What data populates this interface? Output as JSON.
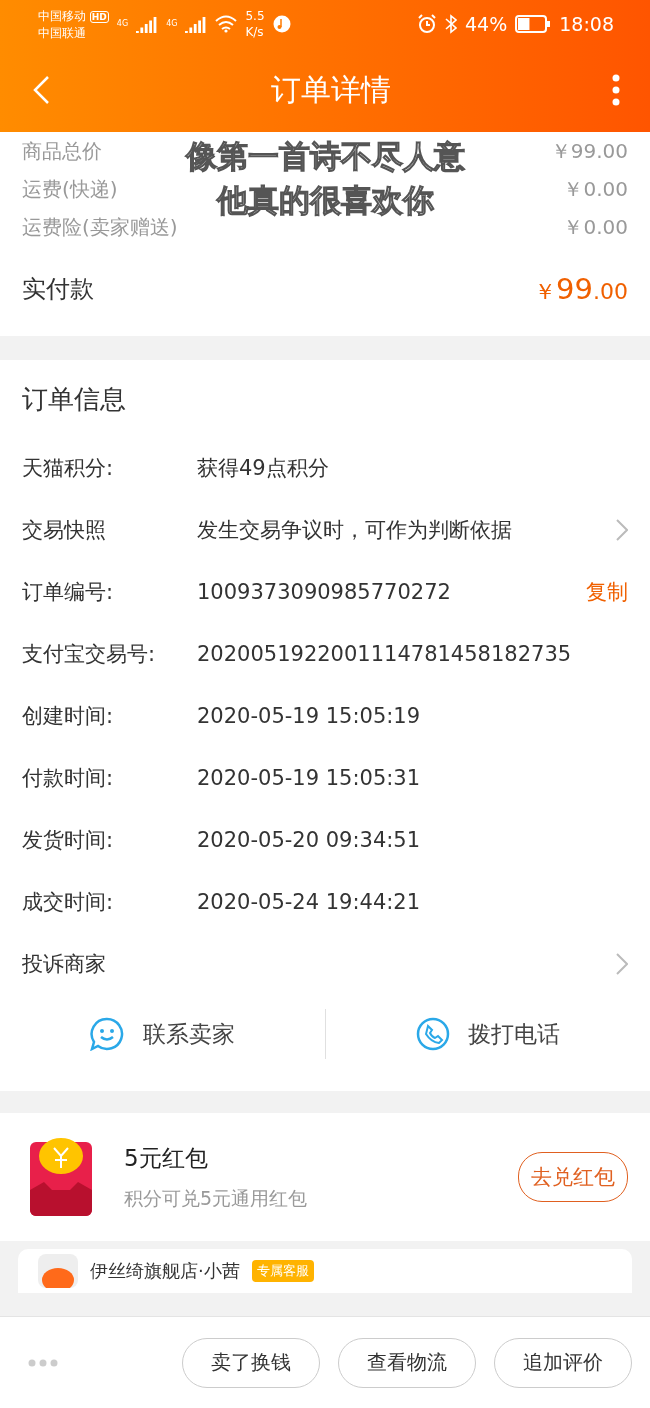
{
  "status_bar": {
    "carrier_1": "中国移动",
    "hd": "HD",
    "carrier_2": "中国联通",
    "net_1": "4G",
    "net_2": "4G",
    "speed_value": "5.5",
    "speed_unit": "K/s",
    "battery": "44%",
    "time": "18:08"
  },
  "nav": {
    "title": "订单详情"
  },
  "caption": [
    "像第一首诗不尽人意",
    "他真的很喜欢你"
  ],
  "price_rows": [
    {
      "label": "商品总价",
      "value": "￥99.00"
    },
    {
      "label": "运费(快递)",
      "value": "￥0.00"
    },
    {
      "label": "运费险(卖家赠送)",
      "value": "￥0.00"
    }
  ],
  "total": {
    "label": "实付款",
    "currency": "￥",
    "integer": "99",
    "decimal": ".00"
  },
  "order_info": {
    "title": "订单信息",
    "rows": [
      {
        "label": "天猫积分:",
        "value": "获得49点积分"
      },
      {
        "label": "交易快照",
        "value": "发生交易争议时，可作为判断依据",
        "kind": "chevron"
      },
      {
        "label": "订单编号:",
        "value": "1009373090985770272",
        "kind": "copy",
        "action": "复制"
      },
      {
        "label": "支付宝交易号:",
        "value": "2020051922001114781458182735"
      },
      {
        "label": "创建时间:",
        "value": "2020-05-19 15:05:19"
      },
      {
        "label": "付款时间:",
        "value": "2020-05-19 15:05:31"
      },
      {
        "label": "发货时间:",
        "value": "2020-05-20 09:34:51"
      },
      {
        "label": "成交时间:",
        "value": "2020-05-24 19:44:21"
      },
      {
        "label": "投诉商家",
        "kind": "chevron"
      }
    ],
    "contacts": [
      {
        "label": "联系卖家",
        "kind": "chat"
      },
      {
        "label": "拨打电话",
        "kind": "phone"
      }
    ]
  },
  "red_packet": {
    "title": "5元红包",
    "subtitle": "积分可兑5元通用红包",
    "button": "去兑红包"
  },
  "store": {
    "name": "伊丝绮旗舰店·小茜",
    "badge": "专属客服"
  },
  "bottom_bar": {
    "buttons": [
      "卖了换钱",
      "查看物流",
      "追加评价"
    ]
  }
}
